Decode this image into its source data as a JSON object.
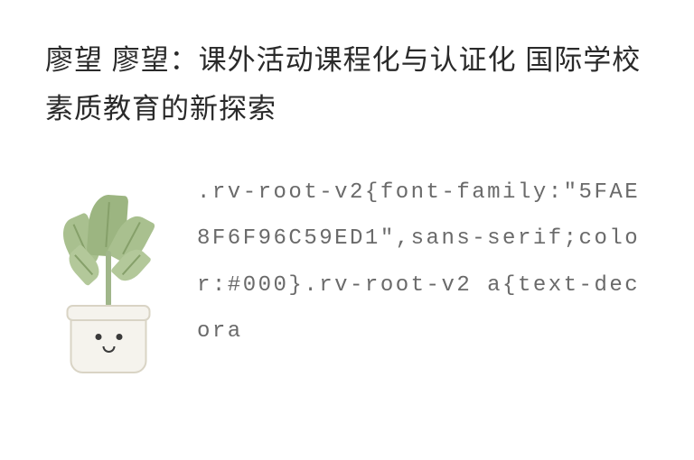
{
  "title": "廖望 廖望：课外活动课程化与认证化 国际学校素质教育的新探索",
  "code_text": ".rv-root-v2{font-family:\"5FAE8F6F96C59ED1\",sans-serif;color:#000}.rv-root-v2 a{text-decora",
  "illustration_name": "potted-plant-illustration"
}
